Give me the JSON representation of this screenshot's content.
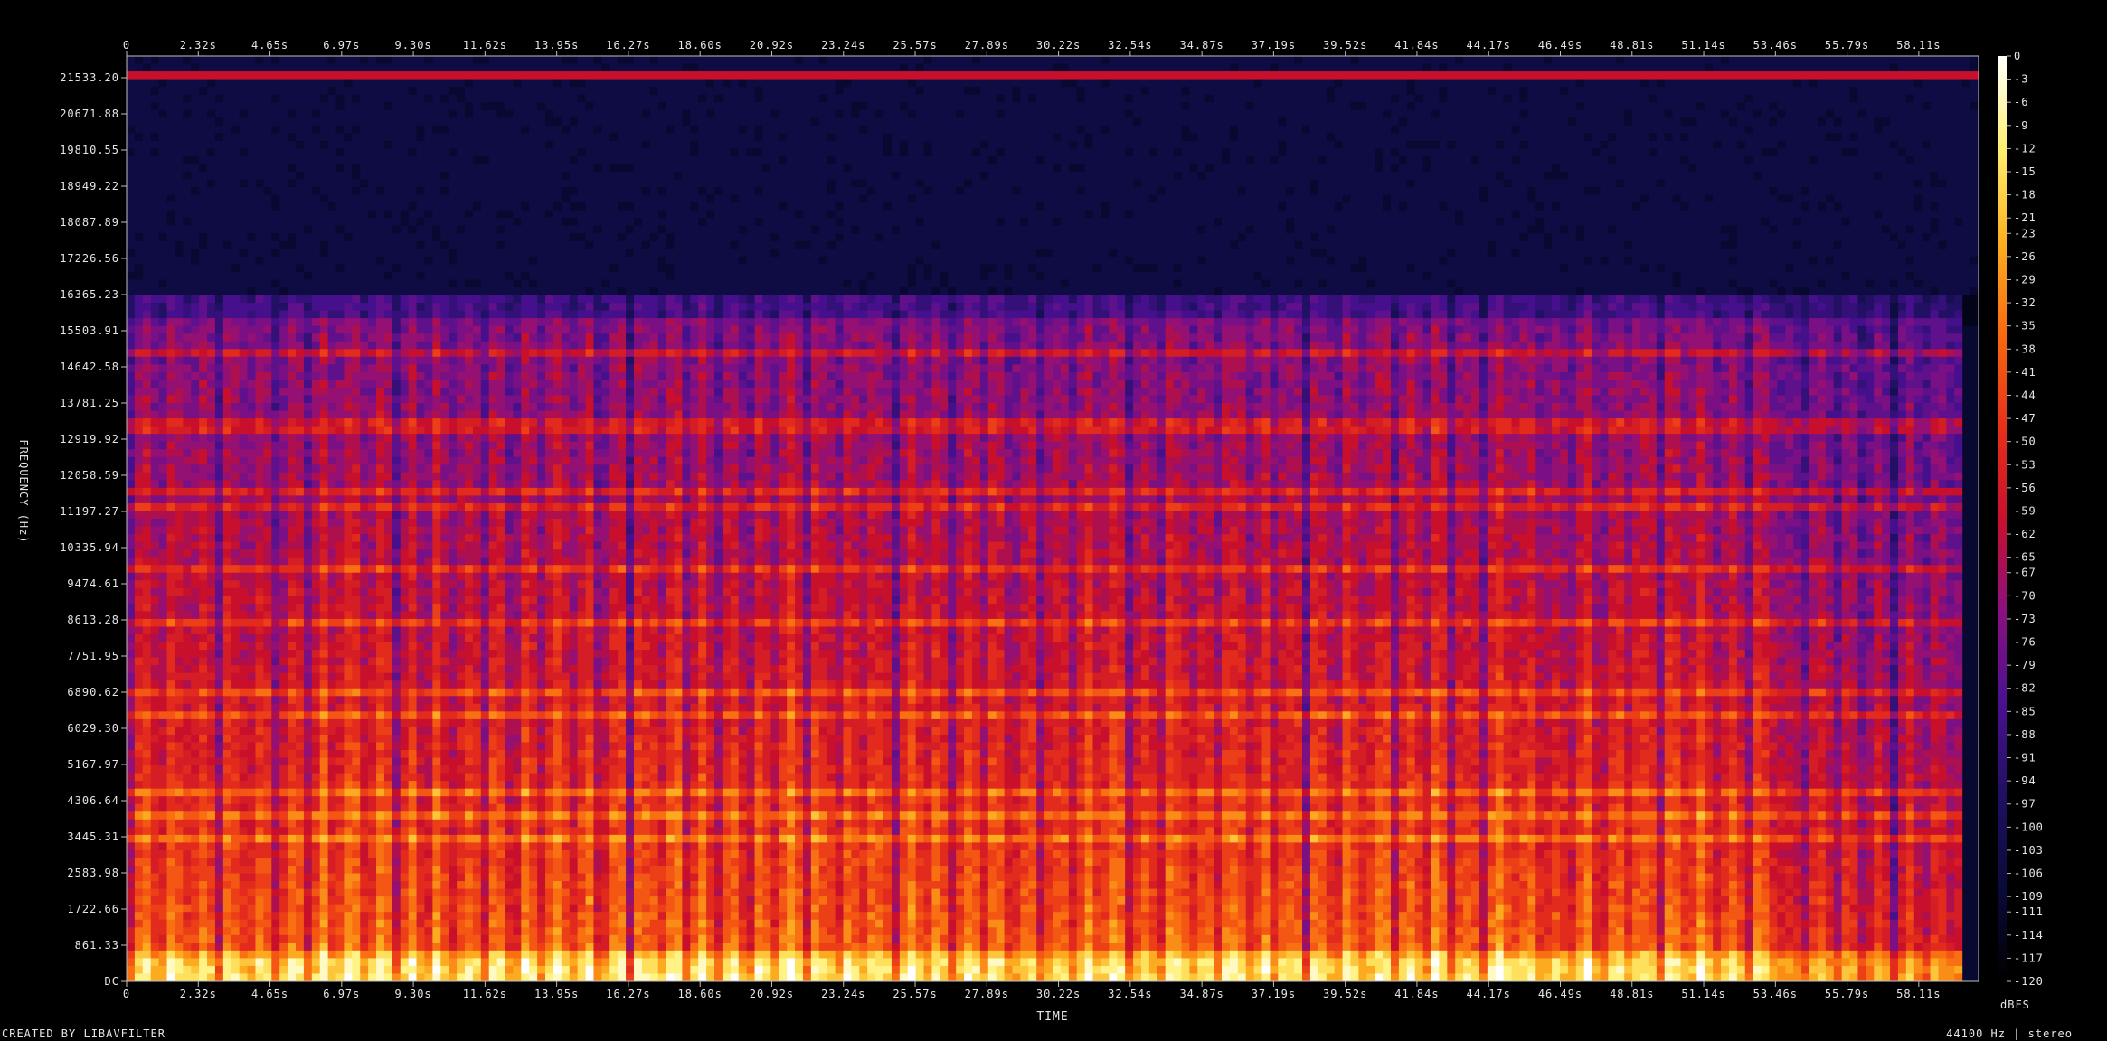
{
  "chart_data": {
    "type": "heatmap",
    "title": "",
    "xlabel": "TIME",
    "ylabel": "FREQUENCY (Hz)",
    "colorbar_label": "dBFS",
    "footer_left": "CREATED BY LIBAVFILTER",
    "footer_right": "44100 Hz | stereo",
    "duration_s": 60.0,
    "x_ticks": [
      "0",
      "2.32s",
      "4.65s",
      "6.97s",
      "9.30s",
      "11.62s",
      "13.95s",
      "16.27s",
      "18.60s",
      "20.92s",
      "23.24s",
      "25.57s",
      "27.89s",
      "30.22s",
      "32.54s",
      "34.87s",
      "37.19s",
      "39.52s",
      "41.84s",
      "44.17s",
      "46.49s",
      "48.81s",
      "51.14s",
      "53.46s",
      "55.79s",
      "58.11s"
    ],
    "y_ticks": [
      "DC",
      "861.33",
      "1722.66",
      "2583.98",
      "3445.31",
      "4306.64",
      "5167.97",
      "6029.30",
      "6890.62",
      "7751.95",
      "8613.28",
      "9474.61",
      "10335.94",
      "11197.27",
      "12058.59",
      "12919.92",
      "13781.25",
      "14642.58",
      "15503.91",
      "16365.23",
      "17226.56",
      "18087.89",
      "18949.22",
      "19810.55",
      "20671.88",
      "21533.20"
    ],
    "colorbar_ticks": [
      "0",
      "-3",
      "-6",
      "-9",
      "-12",
      "-15",
      "-18",
      "-21",
      "-23",
      "-26",
      "-29",
      "-32",
      "-35",
      "-38",
      "-41",
      "-44",
      "-47",
      "-50",
      "-53",
      "-56",
      "-59",
      "-62",
      "-65",
      "-67",
      "-70",
      "-73",
      "-76",
      "-79",
      "-82",
      "-85",
      "-88",
      "-91",
      "-94",
      "-97",
      "-100",
      "-103",
      "-106",
      "-109",
      "-111",
      "-114",
      "-117",
      "-120"
    ],
    "colorbar_range_dbfs": [
      -120,
      0
    ],
    "freq_range_hz": [
      0,
      22050
    ],
    "content_cutoff_hz": 16000,
    "colors": {
      "background": "#000000",
      "text": "#e6e6e6",
      "palette": [
        "#000000",
        "#0a0a3a",
        "#1e1060",
        "#4a1090",
        "#8a1080",
        "#c8102c",
        "#e8301a",
        "#f86a10",
        "#fcb020",
        "#fff070",
        "#ffffff"
      ]
    }
  }
}
